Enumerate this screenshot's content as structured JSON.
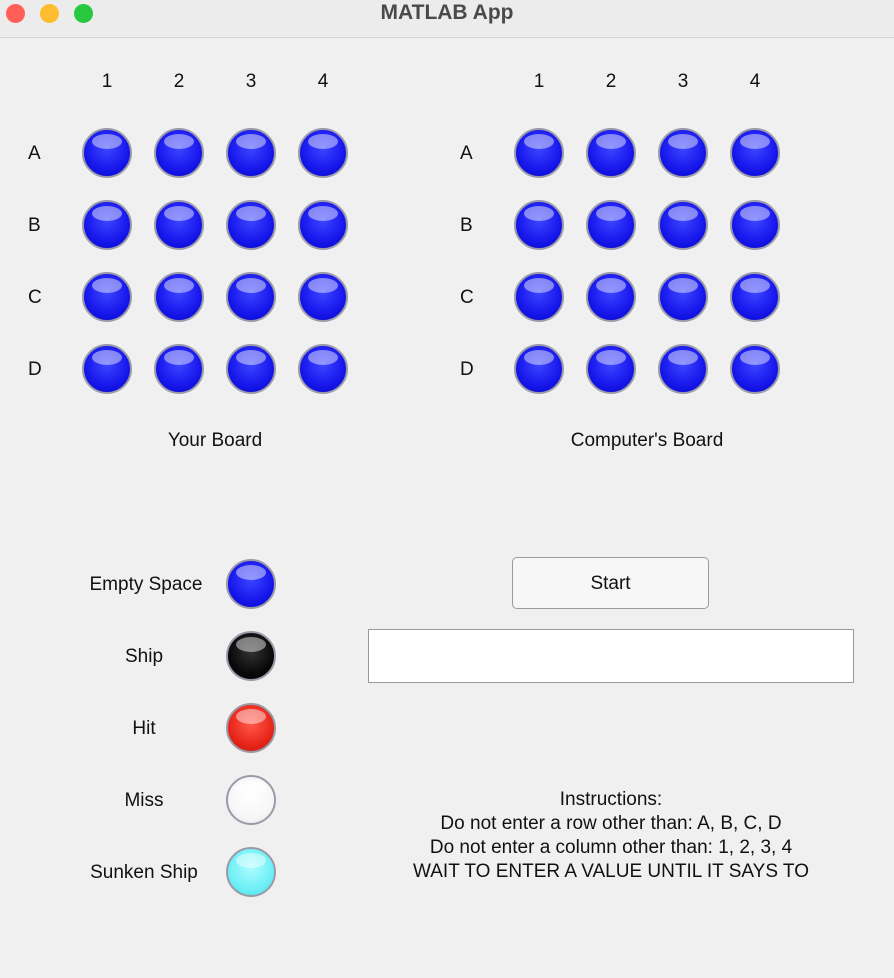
{
  "window": {
    "title": "MATLAB App"
  },
  "your_board": {
    "label": "Your Board",
    "columns": [
      "1",
      "2",
      "3",
      "4"
    ],
    "rows": [
      "A",
      "B",
      "C",
      "D"
    ],
    "cells": [
      [
        "empty",
        "empty",
        "empty",
        "empty"
      ],
      [
        "empty",
        "empty",
        "empty",
        "empty"
      ],
      [
        "empty",
        "empty",
        "empty",
        "empty"
      ],
      [
        "empty",
        "empty",
        "empty",
        "empty"
      ]
    ]
  },
  "computer_board": {
    "label": "Computer's Board",
    "columns": [
      "1",
      "2",
      "3",
      "4"
    ],
    "rows": [
      "A",
      "B",
      "C",
      "D"
    ],
    "cells": [
      [
        "empty",
        "empty",
        "empty",
        "empty"
      ],
      [
        "empty",
        "empty",
        "empty",
        "empty"
      ],
      [
        "empty",
        "empty",
        "empty",
        "empty"
      ],
      [
        "empty",
        "empty",
        "empty",
        "empty"
      ]
    ]
  },
  "legend": [
    {
      "label": "Empty Space",
      "state": "empty",
      "color": "#1a1aee"
    },
    {
      "label": "Ship",
      "state": "ship",
      "color": "#000000"
    },
    {
      "label": "Hit",
      "state": "hit",
      "color": "#e8261a"
    },
    {
      "label": "Miss",
      "state": "miss",
      "color": "#ffffff"
    },
    {
      "label": "Sunken Ship",
      "state": "sunk",
      "color": "#6ff0f6"
    }
  ],
  "controls": {
    "start_label": "Start",
    "input_value": ""
  },
  "instructions": {
    "heading": "Instructions:",
    "lines": [
      "Do not enter a row other than: A, B, C, D",
      "Do not enter a column other than: 1, 2, 3, 4",
      "WAIT TO ENTER A VALUE UNTIL IT SAYS TO"
    ]
  }
}
